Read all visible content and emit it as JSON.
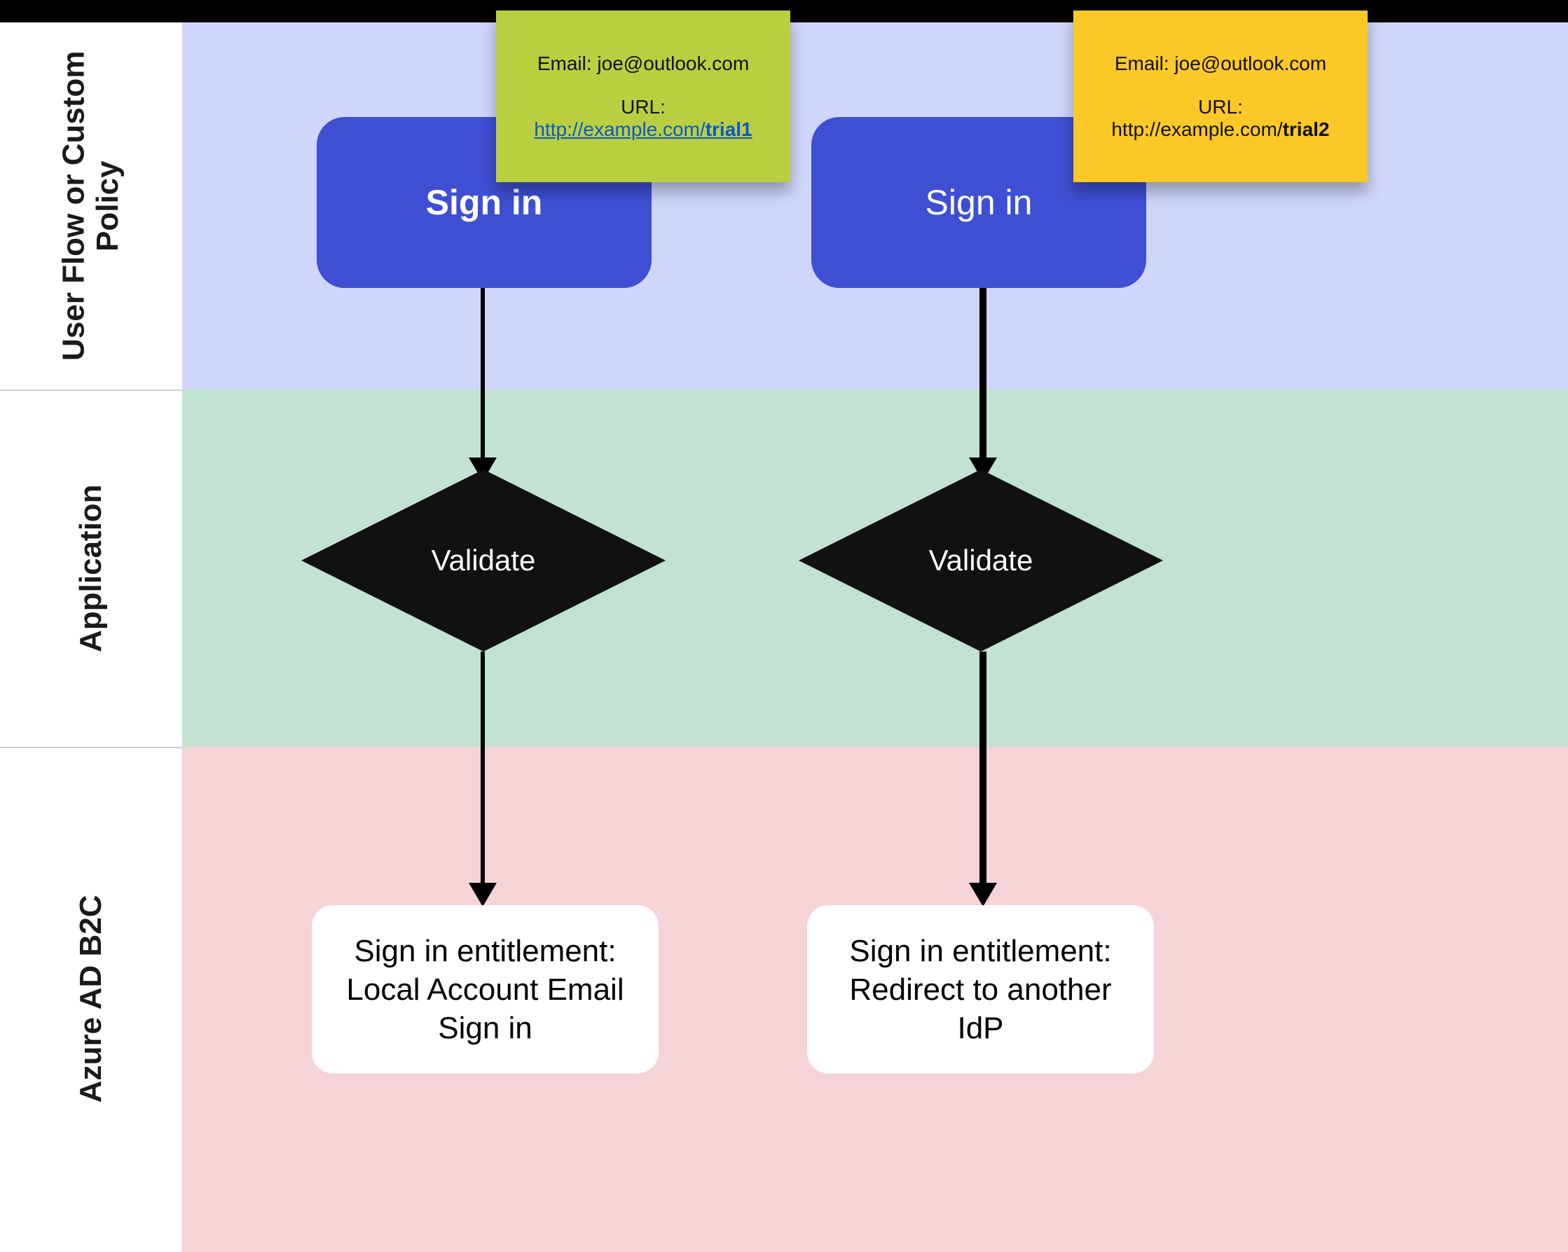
{
  "lanes": {
    "lane1": "User Flow or Custom Policy",
    "lane2": "Application",
    "lane3": "Azure AD B2C"
  },
  "flow_left": {
    "sticky": {
      "email_label": "Email: joe@outlook.com",
      "url_label": "URL:",
      "url_prefix": "http://example.com/",
      "url_suffix": "trial1",
      "url_is_link": true
    },
    "signin": "Sign in",
    "validate": "Validate",
    "result": "Sign in entitlement: Local Account Email Sign in"
  },
  "flow_right": {
    "sticky": {
      "email_label": "Email: joe@outlook.com",
      "url_label": "URL:",
      "url_prefix": "http://example.com/",
      "url_suffix": "trial2",
      "url_is_link": false
    },
    "signin": "Sign in",
    "validate": "Validate",
    "result": "Sign in entitlement: Redirect to another IdP"
  },
  "colors": {
    "lane1": "#d0d6fb",
    "lane2": "#c2e2d2",
    "lane3": "#f6d3d6",
    "node_blue": "#3f4fd3",
    "sticky_green": "#b9cf3f",
    "sticky_yellow": "#fac827"
  }
}
